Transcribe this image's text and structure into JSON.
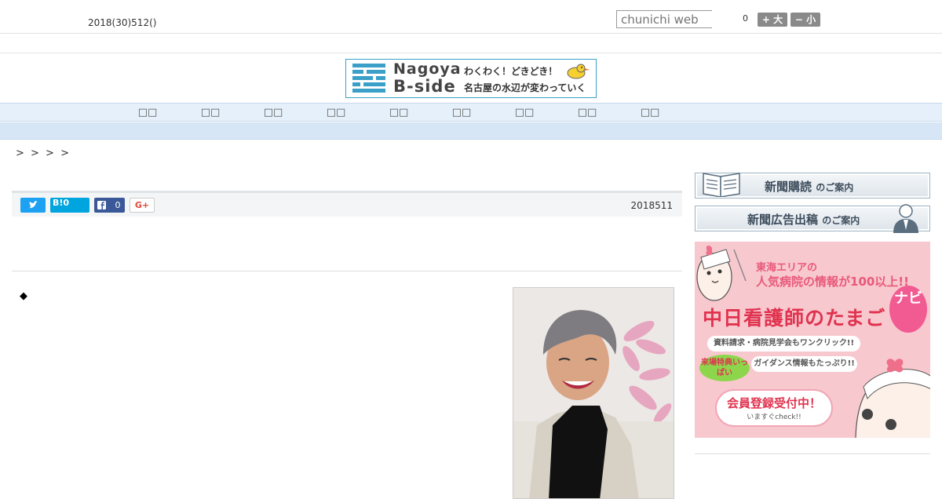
{
  "header": {
    "date": "2018(30)512()",
    "search_placeholder": "chunichi web",
    "counter": "0",
    "font_large": "+ 大",
    "font_small": "− 小"
  },
  "logo": {
    "name_line1": "Nagoya",
    "name_line2": "B-side",
    "tagline1": "わくわく！どきどき！",
    "tagline2": "名古屋の水辺が変わっていく",
    "accent_color": "#3aa0c8"
  },
  "nav": {
    "items": [
      "□□",
      "□□",
      "□□",
      "□□",
      "□□",
      "□□",
      "□□",
      "□□",
      "□□"
    ]
  },
  "breadcrumb": ">   > > >",
  "article": {
    "share": {
      "hatena_label": "B!",
      "hatena_count": "0",
      "facebook_count": "0",
      "gplus_label": "G+"
    },
    "published": "2018511",
    "bullet": "◆"
  },
  "sidebar": {
    "subscribe_main": "新聞購読",
    "subscribe_sub": "のご案内",
    "advertise_main": "新聞広告出稿",
    "advertise_sub": "のご案内",
    "ad": {
      "headline1": "東海エリアの",
      "headline2": "人気病院の情報が100以上!!",
      "title": "中日看護師のたまご",
      "navi": "ナビ",
      "line1": "資料請求・病院見学会もワンクリック!!",
      "tokuten": "来場特典いっぱい",
      "line2": "ガイダンス情報もたっぷり!!",
      "register": "会員登録受付中！",
      "check": "いますぐcheck!!"
    }
  }
}
